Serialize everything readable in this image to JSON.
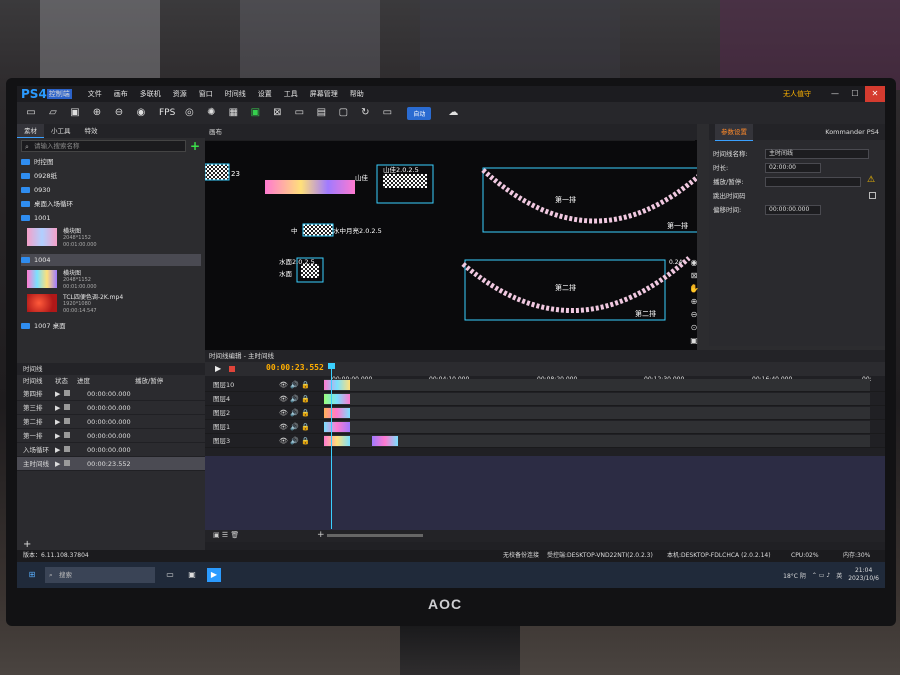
{
  "app": {
    "logo": "PS4",
    "logo_sub": "控制端",
    "menus": [
      "文件",
      "画布",
      "多联机",
      "资源",
      "窗口",
      "时间线",
      "设置",
      "工具",
      "屏幕管理",
      "帮助"
    ],
    "brand_right": "无人值守",
    "product": "Kommander PS4"
  },
  "toolbar": {
    "fps_label": "FPS",
    "pill_label": "自动"
  },
  "left_panel": {
    "tabs": [
      "素材",
      "小工具",
      "特效"
    ],
    "search_placeholder": "请输入搜索名称",
    "folders": [
      "时控图",
      "0928纸",
      "0930",
      "桌面入场循环",
      "1001"
    ],
    "assets_a": [
      {
        "name": "横块图",
        "size": "2048*1152",
        "time": "00:01:00.000"
      }
    ],
    "selected_folder": "1004",
    "assets_b": [
      {
        "name": "横块图",
        "size": "2048*1152",
        "time": "00:01:00.000"
      },
      {
        "name": "TCL四便色调-2K.mp4",
        "size": "1920*1080",
        "time": "00:00:14.547"
      }
    ],
    "last_folder": "1007 桌面"
  },
  "left_timeline": {
    "title": "时间线",
    "headers": [
      "时间线",
      "状态",
      "进度",
      "播放/暂停"
    ],
    "rows": [
      {
        "name": "第四排",
        "time": "00:00:00.000"
      },
      {
        "name": "第三排",
        "time": "00:00:00.000"
      },
      {
        "name": "第二排",
        "time": "00:00:00.000"
      },
      {
        "name": "第一排",
        "time": "00:00:00.000"
      },
      {
        "name": "入场循环",
        "time": "00:00:00.000"
      },
      {
        "name": "主时间线",
        "time": "00:00:23.552"
      }
    ]
  },
  "canvas": {
    "title": "画布",
    "labels": {
      "l1": "23",
      "l2": "山佳2.0.2.5",
      "l3": "山佳",
      "l4": "中",
      "l5": "水中月亮2.0.2.5",
      "l6": "水面2.0.2.5",
      "l7": "水面",
      "row1": "第一排",
      "row1b": "第一排",
      "row2": "第二排",
      "row2b": "第二排",
      "r24": "0.24"
    }
  },
  "params": {
    "title": "参数设置",
    "rows": [
      {
        "label": "时间线名称:",
        "value": "主时间线"
      },
      {
        "label": "时长:",
        "value": "02:00:00"
      },
      {
        "label": "播放/暂停:",
        "value": ""
      },
      {
        "label": "跳出时间码",
        "value": ""
      },
      {
        "label": "偏移时间:",
        "value": "00:00:00.000"
      }
    ]
  },
  "timeline_editor": {
    "title": "时间线编辑 - 主时间线",
    "timecode": "00:00:23.552",
    "ruler": [
      "00:00:00.000",
      "00:04:10.000",
      "00:08:20.000",
      "00:12:30.000",
      "00:16:40.000",
      "00:"
    ],
    "tracks": [
      "图层10",
      "图层4",
      "图层2",
      "图层1",
      "图层3"
    ]
  },
  "status": {
    "version": "版本：6.11.108.37804",
    "s1": "无校备份连接",
    "s2": "受控端:DESKTOP-VND22NTI(2.0.2.3)",
    "s3": "本机:DESKTOP-FDLCHCA (2.0.2.14)",
    "cpu": "CPU:02%",
    "mem": "内存:30%"
  },
  "taskbar": {
    "search": "搜索",
    "weather": "18°C 阴",
    "lang": "英",
    "time": "21:04",
    "date": "2023/10/6"
  },
  "monitor_brand": "AOC",
  "colors": {
    "accent": "#2b9bff",
    "timecode": "#ffae00",
    "playhead": "#3ad0ff",
    "selection": "#3ad0ff"
  }
}
